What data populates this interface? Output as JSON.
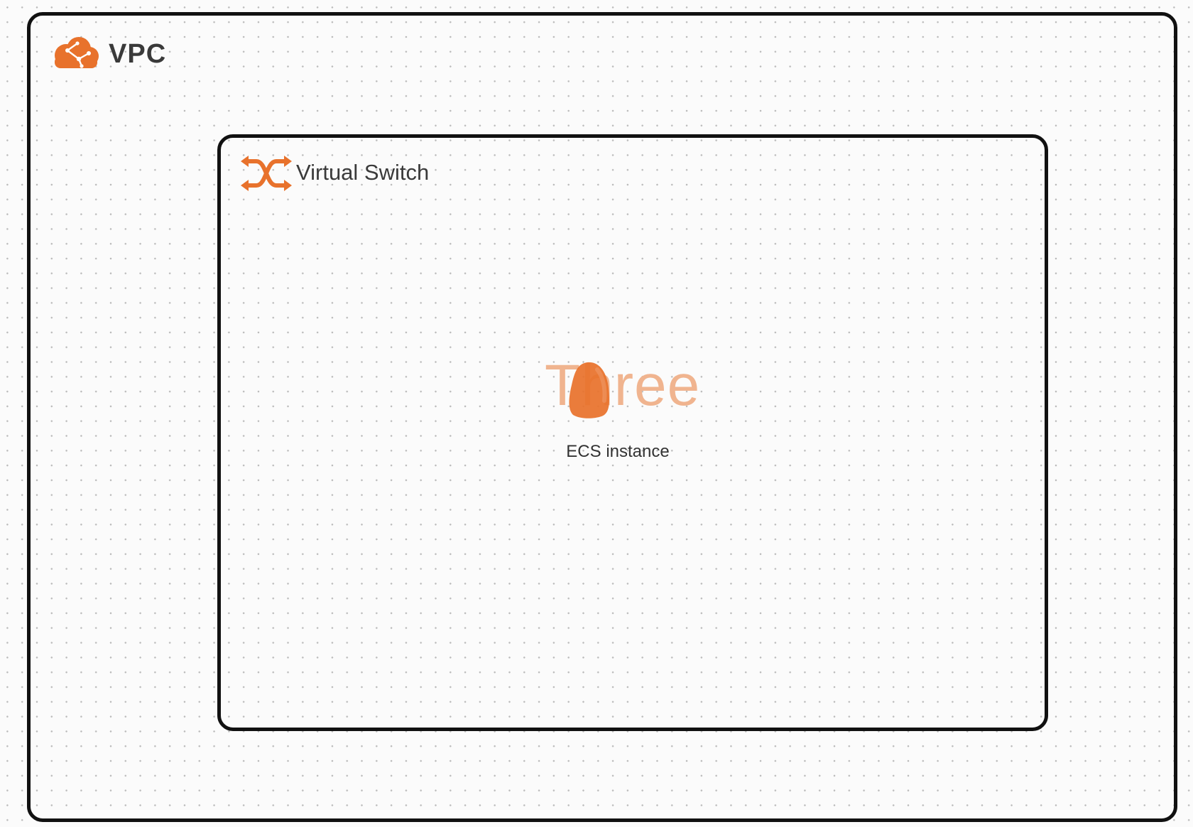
{
  "canvas": {
    "background": "#fbfbfb",
    "grid_dot_color": "#b9b9b9"
  },
  "colors": {
    "accent": "#e8722c",
    "border": "#111111",
    "text": "#3a3a3a"
  },
  "vpc": {
    "label": "VPC",
    "icon": "vpc-cloud-icon"
  },
  "vswitch": {
    "label": "Virtual Switch",
    "icon": "virtual-switch-icon"
  },
  "ecs": {
    "icon_text": "Three",
    "label": "ECS instance",
    "icon": "ecs-instance-icon"
  }
}
